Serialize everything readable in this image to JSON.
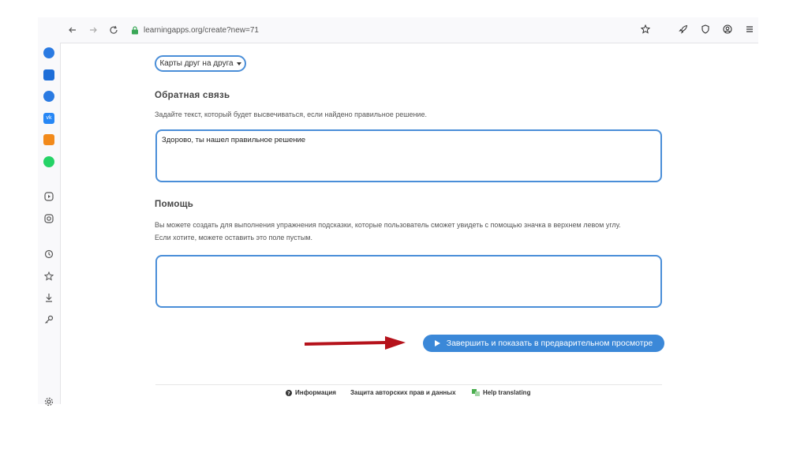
{
  "browser": {
    "url": "learningapps.org/create?new=71"
  },
  "form": {
    "dropdown_value": "Карты друг на друга",
    "feedback": {
      "heading": "Обратная связь",
      "description": "Задайте текст, который будет высвечиваться, если найдено правильное решение.",
      "value": "Здорово, ты нашел правильное решение"
    },
    "help": {
      "heading": "Помощь",
      "description_line1": "Вы можете создать для выполнения упражнения подсказки, которые пользователь сможет увидеть с помощью значка в верхнем левом углу.",
      "description_line2": "Если хотите, можете оставить это поле пустым.",
      "value": ""
    },
    "submit_label": "Завершить и показать в предварительном просмотре"
  },
  "footer": {
    "info": "Информация",
    "copyright": "Защита авторских прав и данных",
    "help_translating": "Help translating"
  },
  "colors": {
    "accent": "#3b88d8",
    "arrow": "#b5121b"
  }
}
